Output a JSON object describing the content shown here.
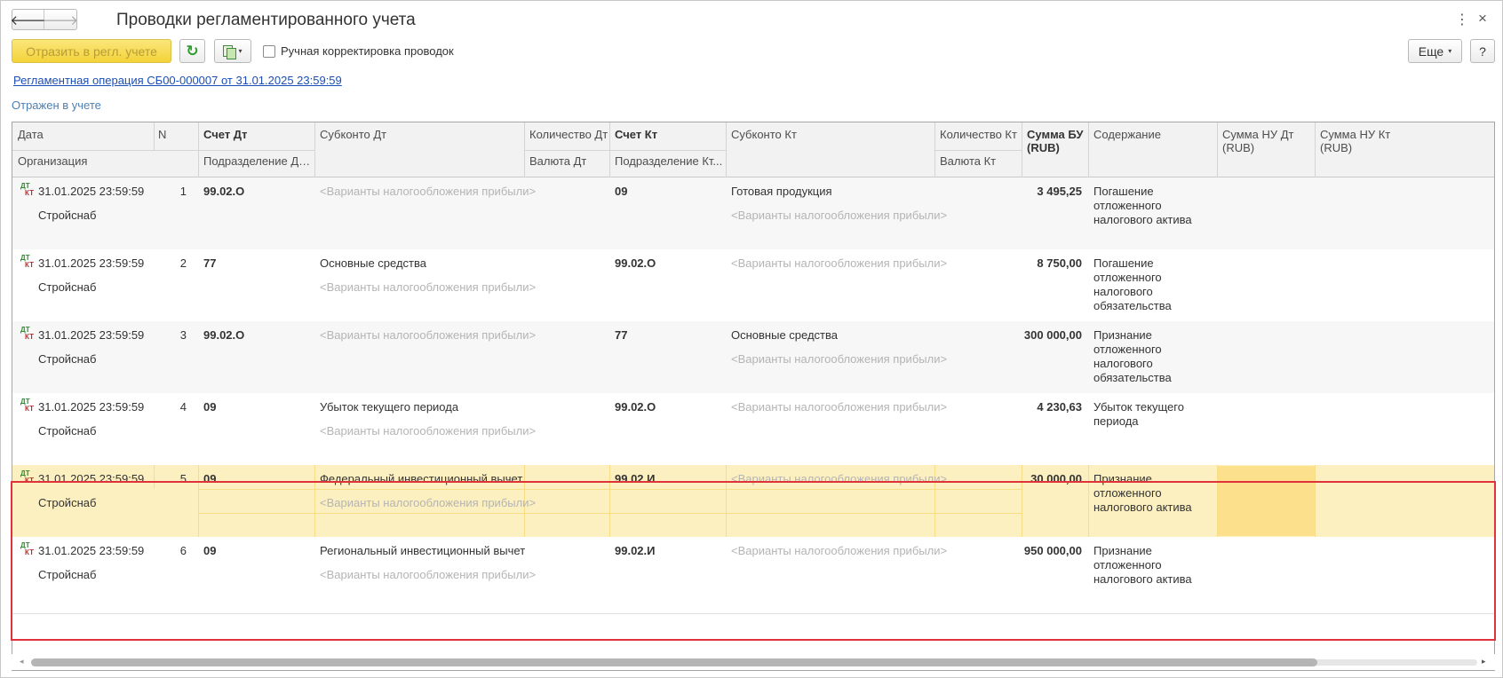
{
  "window": {
    "title": "Проводки регламентированного учета",
    "back_glyph": "🡐",
    "forward_glyph": "🡒",
    "menu_glyph": "⋮",
    "close_glyph": "×"
  },
  "toolbar": {
    "reflect_label": "Отразить в регл. учете",
    "refresh_icon": "↻",
    "manual_checkbox_label": "Ручная корректировка проводок",
    "manual_checked": false,
    "more_label": "Еще",
    "more_caret": "▾",
    "docs_caret": "▾",
    "help_label": "?"
  },
  "operation_link": "Регламентная операция СБ00-000007 от 31.01.2025 23:59:59",
  "status_text": "Отражен в учете",
  "columns": {
    "date": "Дата",
    "n": "N",
    "account_dt": "Счет Дт",
    "subconto_dt": "Субконто Дт",
    "qty_dt": "Количество Дт",
    "account_kt": "Счет Кт",
    "subconto_kt": "Субконто Кт",
    "qty_kt": "Количество Кт",
    "sum_bu": "Сумма БУ (RUB)",
    "content": "Содержание",
    "sum_nu_dt": "Сумма НУ Дт (RUB)",
    "sum_nu_kt": "Сумма НУ Кт (RUB)",
    "organization": "Организация",
    "division_dt": "Подразделение Дт...",
    "currency_dt": "Валюта Дт",
    "division_kt": "Подразделение Кт...",
    "currency_kt": "Валюта Кт"
  },
  "icon_labels": {
    "dt": "ДТ",
    "kt": "КТ"
  },
  "rows": [
    {
      "date": "31.01.2025 23:59:59",
      "n": "1",
      "org": "Стройснаб",
      "account_dt": "99.02.О",
      "subconto_dt_1": "<Варианты налогообложения прибыли>",
      "subconto_dt_2": "",
      "account_kt": "09",
      "subconto_kt_1": "Готовая продукция",
      "subconto_kt_2": "<Варианты налогообложения прибыли>",
      "sum_bu": "3 495,25",
      "content": "Погашение отложенного налогового актива"
    },
    {
      "date": "31.01.2025 23:59:59",
      "n": "2",
      "org": "Стройснаб",
      "account_dt": "77",
      "subconto_dt_1": "Основные средства",
      "subconto_dt_2": "<Варианты налогообложения прибыли>",
      "account_kt": "99.02.О",
      "subconto_kt_1": "<Варианты налогообложения прибыли>",
      "subconto_kt_2": "",
      "sum_bu": "8 750,00",
      "content": "Погашение отложенного налогового обязательства"
    },
    {
      "date": "31.01.2025 23:59:59",
      "n": "3",
      "org": "Стройснаб",
      "account_dt": "99.02.О",
      "subconto_dt_1": "<Варианты налогообложения прибыли>",
      "subconto_dt_2": "",
      "account_kt": "77",
      "subconto_kt_1": "Основные средства",
      "subconto_kt_2": "<Варианты налогообложения прибыли>",
      "sum_bu": "300 000,00",
      "content": "Признание отложенного налогового обязательства"
    },
    {
      "date": "31.01.2025 23:59:59",
      "n": "4",
      "org": "Стройснаб",
      "account_dt": "09",
      "subconto_dt_1": "Убыток текущего периода",
      "subconto_dt_2": "<Варианты налогообложения прибыли>",
      "account_kt": "99.02.О",
      "subconto_kt_1": "<Варианты налогообложения прибыли>",
      "subconto_kt_2": "",
      "sum_bu": "4 230,63",
      "content": "Убыток текущего периода"
    },
    {
      "date": "31.01.2025 23:59:59",
      "n": "5",
      "org": "Стройснаб",
      "account_dt": "09",
      "subconto_dt_1": "Федеральный инвестиционный вычет",
      "subconto_dt_2": "<Варианты налогообложения прибыли>",
      "account_kt": "99.02.И",
      "subconto_kt_1": "<Варианты налогообложения прибыли>",
      "subconto_kt_2": "",
      "sum_bu": "30 000,00",
      "content": "Признание отложенного налогового актива"
    },
    {
      "date": "31.01.2025 23:59:59",
      "n": "6",
      "org": "Стройснаб",
      "account_dt": "09",
      "subconto_dt_1": "Региональный инвестиционный вычет",
      "subconto_dt_2": "<Варианты налогообложения прибыли>",
      "account_kt": "99.02.И",
      "subconto_kt_1": "<Варианты налогообложения прибыли>",
      "subconto_kt_2": "",
      "sum_bu": "950 000,00",
      "content": "Признание отложенного налогового актива"
    }
  ],
  "scroll_arrows": {
    "left": "◂",
    "right": "▸"
  },
  "colors": {
    "accent_yellow": "#f3d339",
    "selection": "#fdf0c0",
    "highlight_border": "#e0323a",
    "link": "#1c4fb4"
  }
}
